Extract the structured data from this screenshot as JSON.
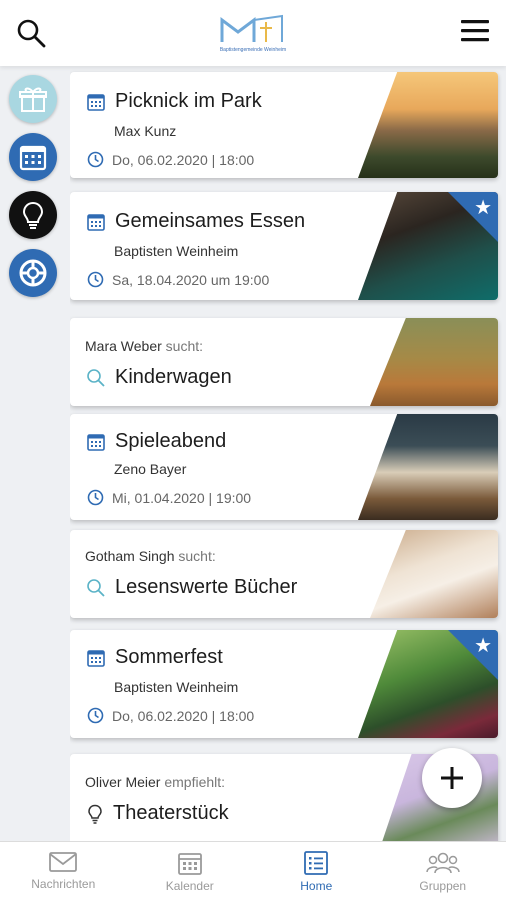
{
  "header": {
    "logo_text": "Baptistengemeinde Weinheim",
    "search_icon": "search-icon",
    "menu_icon": "hamburger-menu-icon"
  },
  "rail": [
    {
      "name": "gift",
      "icon": "gift-icon",
      "bg": "#a9d7e1"
    },
    {
      "name": "calendar",
      "icon": "calendar-icon",
      "bg": "#2f6bb3"
    },
    {
      "name": "lightbulb",
      "icon": "lightbulb-icon",
      "bg": "#111111"
    },
    {
      "name": "lifebuoy",
      "icon": "lifebuoy-icon",
      "bg": "#2f6bb3"
    }
  ],
  "feed": {
    "events": [
      {
        "title": "Picknick im Park",
        "host": "Max Kunz",
        "date": "Do, 06.02.2020 | 18:00",
        "starred": false
      },
      {
        "title": "Gemeinsames Essen",
        "host": "Baptisten Weinheim",
        "date": "Sa, 18.04.2020 um 19:00",
        "starred": true
      },
      {
        "title": "Spieleabend",
        "host": "Zeno Bayer",
        "date": "Mi, 01.04.2020 | 19:00",
        "starred": false
      },
      {
        "title": "Sommerfest",
        "host": "Baptisten Weinheim",
        "date": "Do, 06.02.2020 | 18:00",
        "starred": true
      }
    ],
    "searches": [
      {
        "person": "Mara Weber",
        "verb": "sucht:",
        "item": "Kinderwagen"
      },
      {
        "person": "Gotham Singh",
        "verb": "sucht:",
        "item": "Lesenswerte Bücher"
      }
    ],
    "recommendation": {
      "person": "Oliver Meier",
      "verb": "empfiehlt:",
      "item": "Theaterstück"
    }
  },
  "fab": {
    "icon": "plus-icon"
  },
  "nav": [
    {
      "label": "Nachrichten",
      "icon": "envelope-icon",
      "active": false
    },
    {
      "label": "Kalender",
      "icon": "calendar-icon",
      "active": false
    },
    {
      "label": "Home",
      "icon": "list-icon",
      "active": true
    },
    {
      "label": "Gruppen",
      "icon": "group-icon",
      "active": false
    }
  ],
  "colors": {
    "accent": "#2f6bb3",
    "search_teal": "#5bb3c7",
    "background": "#eef0f3"
  }
}
